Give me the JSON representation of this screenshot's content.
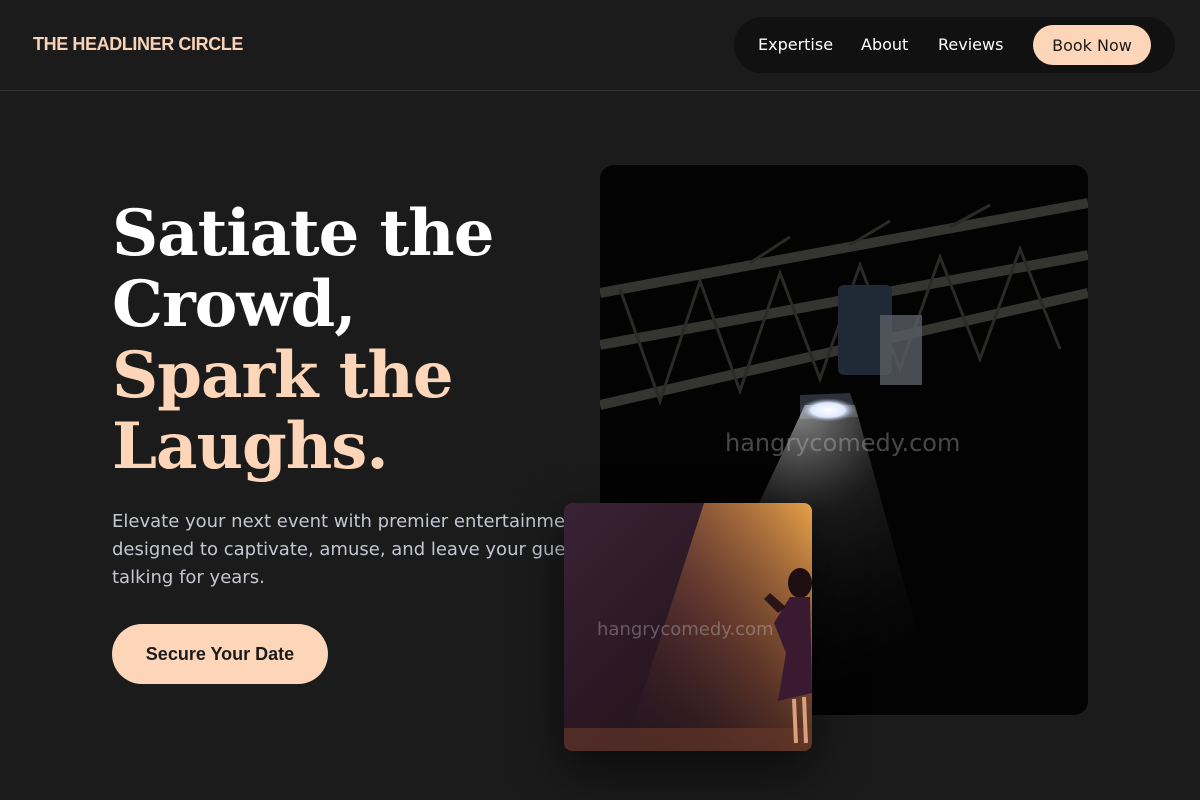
{
  "brand": {
    "name": "THE HEADLINER CIRCLE"
  },
  "nav": {
    "links": [
      "Expertise",
      "About",
      "Reviews"
    ],
    "book_label": "Book Now"
  },
  "hero": {
    "headline_white_1": "Satiate the",
    "headline_white_2": "Crowd,",
    "headline_accent_1": "Spark the",
    "headline_accent_2": "Laughs.",
    "subtext": "Elevate your next event with premier entertainment designed to captivate, amuse, and leave your guests talking for years.",
    "cta_label": "Secure Your Date"
  },
  "images": {
    "main_watermark": "hangrycomedy.com",
    "sub_watermark": "hangrycomedy.com"
  },
  "colors": {
    "accent": "#fdd6b9",
    "background": "#1b1b1b",
    "nav_pill": "#111111"
  }
}
